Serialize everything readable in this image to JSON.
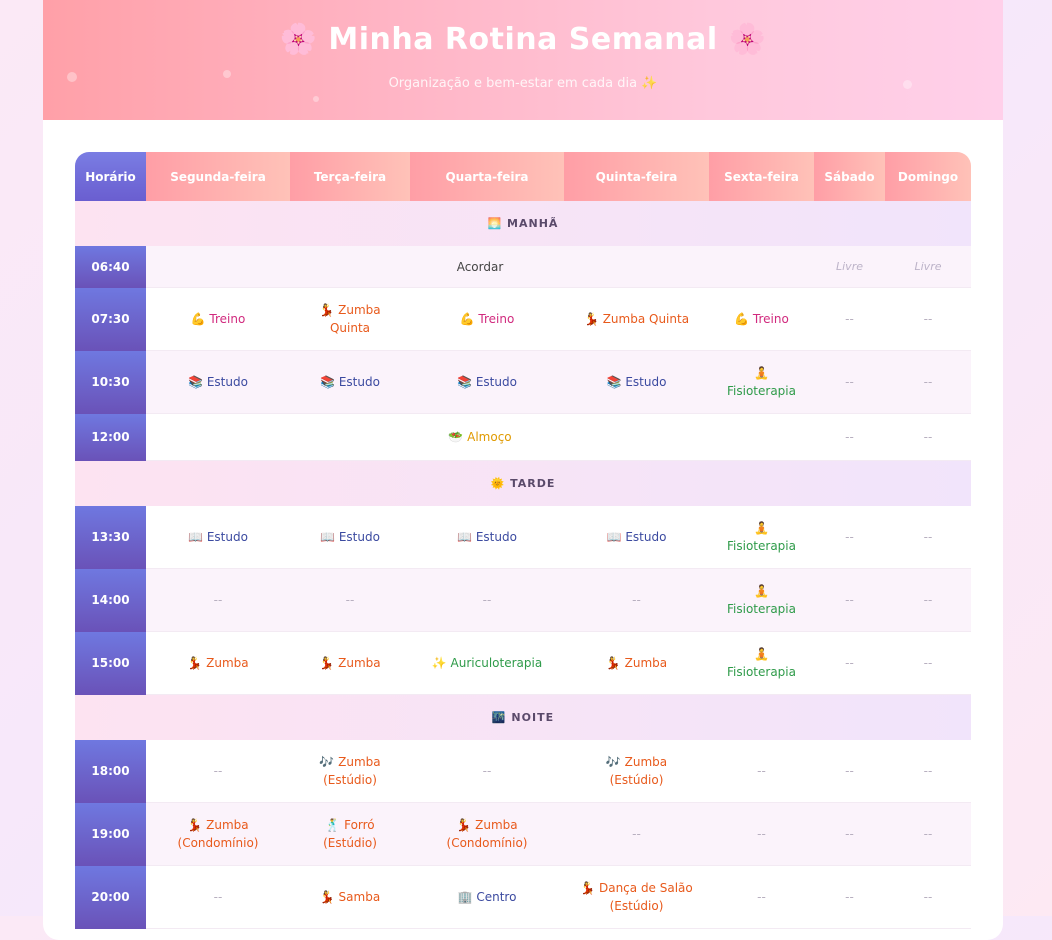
{
  "header": {
    "title": "🌸 Minha Rotina Semanal 🌸",
    "subtitle": "Organização e bem-estar em cada dia ✨"
  },
  "columns": [
    "Horário",
    "Segunda-feira",
    "Terça-feira",
    "Quarta-feira",
    "Quinta-feira",
    "Sexta-feira",
    "Sábado",
    "Domingo"
  ],
  "sections": {
    "manha": "🌅 MANHÃ",
    "tarde": "🌞 TARDE",
    "noite": "🌃 NOITE"
  },
  "rows": {
    "r0640": {
      "time": "06:40",
      "all": "Acordar",
      "sab": "Livre",
      "dom": "Livre"
    },
    "r0730": {
      "time": "07:30",
      "seg": "💪 Treino",
      "ter1": "💃 Zumba",
      "ter2": "Quinta",
      "qua": "💪 Treino",
      "qui": "💃 Zumba Quinta",
      "sex": "💪 Treino",
      "sab": "--",
      "dom": "--"
    },
    "r1030": {
      "time": "10:30",
      "seg": "📚 Estudo",
      "ter": "📚 Estudo",
      "qua": "📚 Estudo",
      "qui": "📚 Estudo",
      "sex_icon": "🧘",
      "sex": "Fisioterapia",
      "sab": "--",
      "dom": "--"
    },
    "r1200": {
      "time": "12:00",
      "all": "🥗 Almoço",
      "sab": "--",
      "dom": "--"
    },
    "r1330": {
      "time": "13:30",
      "seg": "📖 Estudo",
      "ter": "📖 Estudo",
      "qua": "📖 Estudo",
      "qui": "📖 Estudo",
      "sex_icon": "🧘",
      "sex": "Fisioterapia",
      "sab": "--",
      "dom": "--"
    },
    "r1400": {
      "time": "14:00",
      "seg": "--",
      "ter": "--",
      "qua": "--",
      "qui": "--",
      "sex_icon": "🧘",
      "sex": "Fisioterapia",
      "sab": "--",
      "dom": "--"
    },
    "r1500": {
      "time": "15:00",
      "seg": "💃 Zumba",
      "ter": "💃 Zumba",
      "qua": "✨ Auriculoterapia",
      "qui": "💃 Zumba",
      "sex_icon": "🧘",
      "sex": "Fisioterapia",
      "sab": "--",
      "dom": "--"
    },
    "r1800": {
      "time": "18:00",
      "seg": "--",
      "ter1": "🎶 Zumba",
      "ter2": "(Estúdio)",
      "qua": "--",
      "qui1": "🎶 Zumba",
      "qui2": "(Estúdio)",
      "sex": "--",
      "sab": "--",
      "dom": "--"
    },
    "r1900": {
      "time": "19:00",
      "seg1": "💃 Zumba",
      "seg2": "(Condomínio)",
      "ter1": "🕺 Forró",
      "ter2": "(Estúdio)",
      "qua1": "💃 Zumba",
      "qua2": "(Condomínio)",
      "qui": "--",
      "sex": "--",
      "sab": "--",
      "dom": "--"
    },
    "r2000": {
      "time": "20:00",
      "seg": "--",
      "ter": "💃 Samba",
      "qua": "🏢 Centro",
      "qui1": "💃 Dança de Salão",
      "qui2": "(Estúdio)",
      "sex": "--",
      "sab": "--",
      "dom": "--"
    }
  }
}
